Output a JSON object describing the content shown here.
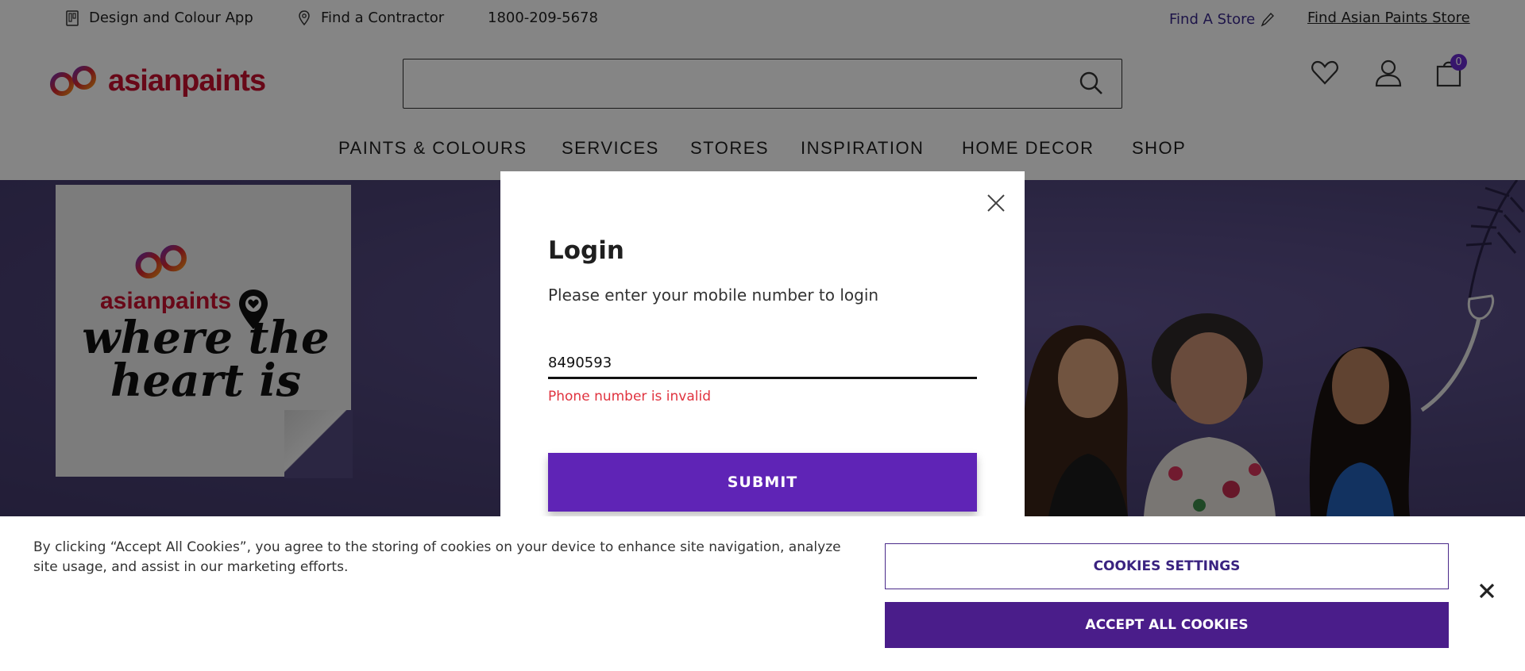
{
  "topbar": {
    "design_app": "Design and Colour App",
    "find_contractor": "Find a Contractor",
    "phone": "1800-209-5678",
    "find_store": "Find A Store",
    "find_ap_store": "Find Asian Paints Store"
  },
  "header": {
    "brand": "asianpaints",
    "search_placeholder": "",
    "cart_count": "0"
  },
  "nav": {
    "items": [
      "PAINTS & COLOURS",
      "SERVICES",
      "STORES",
      "INSPIRATION",
      "HOME DECOR",
      "SHOP"
    ]
  },
  "hero": {
    "brand": "asianpaints",
    "tagline": "where the heart is"
  },
  "login": {
    "title": "Login",
    "subtitle": "Please enter your mobile number to login",
    "phone_value": "8490593",
    "error": "Phone number is invalid",
    "submit_label": "SUBMIT"
  },
  "cookie": {
    "message": "By clicking “Accept All Cookies”, you agree to the storing of cookies on your device to enhance site navigation, analyze site usage, and assist in our marketing efforts.",
    "settings_label": "COOKIES SETTINGS",
    "accept_label": "ACCEPT ALL COOKIES"
  },
  "colors": {
    "brand_red": "#c8102e",
    "primary_purple": "#5f24b6",
    "accept_purple": "#4a1d8a",
    "error_red": "#e0333f"
  },
  "icons": [
    "phone-app-icon",
    "location-pin-icon",
    "pencil-icon",
    "search-icon",
    "heart-icon",
    "user-icon",
    "cart-icon",
    "close-icon"
  ]
}
